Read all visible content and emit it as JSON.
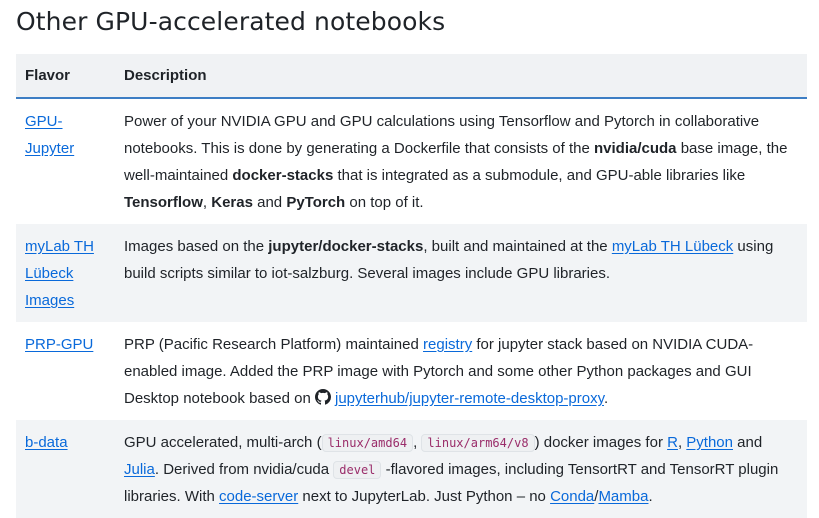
{
  "title": "Other GPU-accelerated notebooks",
  "table": {
    "headers": {
      "flavor": "Flavor",
      "description": "Description"
    },
    "rows": [
      {
        "flavor_line1": "GPU-",
        "flavor_line2": "Jupyter",
        "desc": {
          "t1": "Power of your NVIDIA GPU and GPU calculations using Tensorflow and Pytorch in collaborative notebooks. This is done by generating a Dockerfile that consists of the ",
          "b1": "nvidia/cuda",
          "t2": " base image, the well-maintained ",
          "b2": "docker-stacks",
          "t3": " that is integrated as a submodule, and GPU-able libraries like ",
          "b3": "Tensorflow",
          "t4": ", ",
          "b4": "Keras",
          "t5": " and ",
          "b5": "PyTorch",
          "t6": " on top of it."
        }
      },
      {
        "flavor_line1": "myLab TH",
        "flavor_line2": "Lübeck",
        "flavor_line3": "Images",
        "desc": {
          "t1": "Images based on the ",
          "b1": "jupyter/docker-stacks",
          "t2": ", built and maintained at the ",
          "l1": "myLab TH Lübeck",
          "t3": " using build scripts similar to iot-salzburg. Several images include GPU libraries."
        }
      },
      {
        "flavor": "PRP-GPU",
        "desc": {
          "t1": "PRP (Pacific Research Platform) maintained ",
          "l1": "registry",
          "t2": " for jupyter stack based on NVIDIA CUDA-enabled image. Added the PRP image with Pytorch and some other Python packages and GUI Desktop notebook based on ",
          "icon": "github-icon",
          "l2": "jupyterhub/jupyter-remote-desktop-proxy",
          "t3": "."
        }
      },
      {
        "flavor": "b-data",
        "desc": {
          "t1": "GPU accelerated, multi-arch (",
          "c1": "linux/amd64",
          "t2": ", ",
          "c2": "linux/arm64/v8",
          "t3": ") docker images for ",
          "l1": "R",
          "t4": ", ",
          "l2": "Python",
          "t5": " and ",
          "l3": "Julia",
          "t6": ". Derived from nvidia/cuda ",
          "c3": "devel",
          "t7": " -flavored images, including TensortRT and TensorRT plugin libraries. With ",
          "l4": "code-server",
          "t8": " next to JupyterLab. Just Python – no ",
          "l5": "Conda",
          "t9": "/",
          "l6": "Mamba",
          "t10": "."
        }
      }
    ]
  },
  "colors": {
    "link": "#0969da",
    "header_bg": "#f0f2f4",
    "header_rule": "#3d7ec4",
    "alt_row_bg": "#f2f4f6"
  }
}
